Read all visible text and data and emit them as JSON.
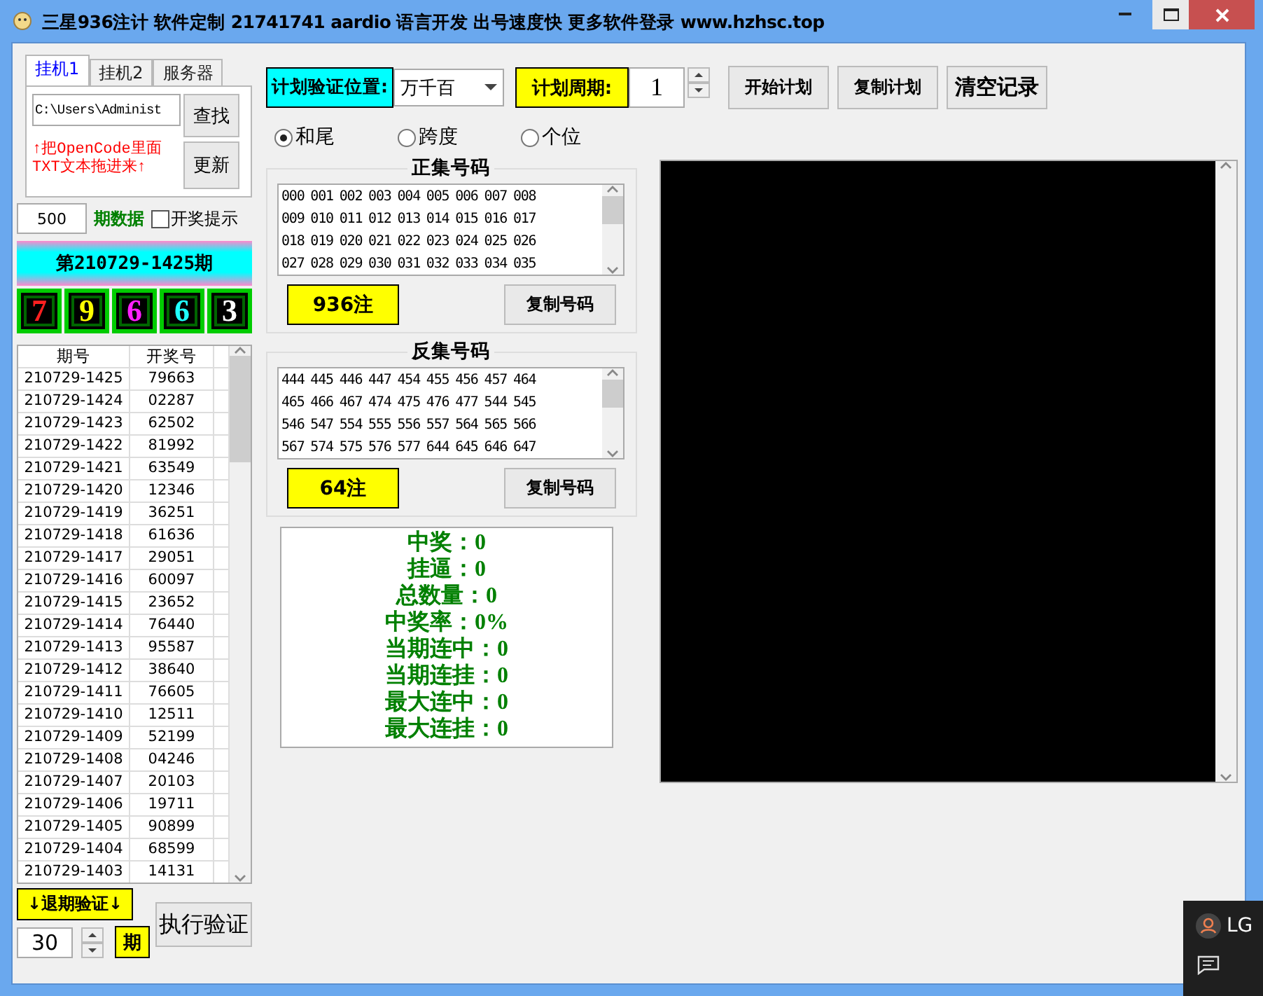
{
  "window": {
    "title": "三星936注计 软件定制 21741741 aardio 语言开发 出号速度快 更多软件登录 www.hzhsc.top"
  },
  "tabs": [
    {
      "label": "挂机1",
      "selected": true
    },
    {
      "label": "挂机2",
      "selected": false
    },
    {
      "label": "服务器",
      "selected": false
    }
  ],
  "path_field": {
    "value": "C:\\Users\\Administ"
  },
  "find_button": "查找",
  "drag_hint": "↑把OpenCode里面TXT文本拖进来↑",
  "update_button": "更新",
  "periods_field": {
    "value": "500"
  },
  "periods_label": "期数据",
  "draw_alert": {
    "label": "开奖提示",
    "checked": false
  },
  "current_period": "第210729-1425期",
  "digits": [
    {
      "value": "7",
      "color": "#ff2020"
    },
    {
      "value": "9",
      "color": "#ffff00"
    },
    {
      "value": "6",
      "color": "#ff20ff"
    },
    {
      "value": "6",
      "color": "#20ffff"
    },
    {
      "value": "3",
      "color": "#ffffff"
    }
  ],
  "table": {
    "columns": [
      "期号",
      "开奖号"
    ],
    "rows": [
      [
        "210729-1425",
        "79663"
      ],
      [
        "210729-1424",
        "02287"
      ],
      [
        "210729-1423",
        "62502"
      ],
      [
        "210729-1422",
        "81992"
      ],
      [
        "210729-1421",
        "63549"
      ],
      [
        "210729-1420",
        "12346"
      ],
      [
        "210729-1419",
        "36251"
      ],
      [
        "210729-1418",
        "61636"
      ],
      [
        "210729-1417",
        "29051"
      ],
      [
        "210729-1416",
        "60097"
      ],
      [
        "210729-1415",
        "23652"
      ],
      [
        "210729-1414",
        "76440"
      ],
      [
        "210729-1413",
        "95587"
      ],
      [
        "210729-1412",
        "38640"
      ],
      [
        "210729-1411",
        "76605"
      ],
      [
        "210729-1410",
        "12511"
      ],
      [
        "210729-1409",
        "52199"
      ],
      [
        "210729-1408",
        "04246"
      ],
      [
        "210729-1407",
        "20103"
      ],
      [
        "210729-1406",
        "19711"
      ],
      [
        "210729-1405",
        "90899"
      ],
      [
        "210729-1404",
        "68599"
      ],
      [
        "210729-1403",
        "14131"
      ]
    ]
  },
  "backtest_label": "↓退期验证↓",
  "backtest_field": {
    "value": "30"
  },
  "backtest_unit": "期",
  "run_button": "执行验证",
  "plan_position": {
    "label": "计划验证位置:",
    "value": "万千百"
  },
  "plan_cycle": {
    "label": "计划周期:",
    "value": "1"
  },
  "toolbar_buttons": [
    "开始计划",
    "复制计划",
    "清空记录"
  ],
  "modes": [
    {
      "label": "和尾",
      "selected": true
    },
    {
      "label": "跨度",
      "selected": false
    },
    {
      "label": "个位",
      "selected": false
    }
  ],
  "groups": [
    {
      "title": "正集号码",
      "lines": [
        "000 001 002 003 004 005 006 007 008",
        "009 010 011 012 013 014 015 016 017",
        "018 019 020 021 022 023 024 025 026",
        "027 028 029 030 031 032 033 034 035"
      ],
      "count": "936注",
      "copy_button": "复制号码"
    },
    {
      "title": "反集号码",
      "lines": [
        "444 445 446 447 454 455 456 457 464",
        "465 466 467 474 475 476 477 544 545",
        "546 547 554 555 556 557 564 565 566",
        "567 574 575 576 577 644 645 646 647"
      ],
      "count": "64注",
      "copy_button": "复制号码"
    }
  ],
  "stats": [
    "中奖：0",
    "挂逼：0",
    "总数量：0",
    "中奖率：0%",
    "当期连中：0",
    "当期连挂：0",
    "最大连中：0",
    "最大连挂：0"
  ],
  "taskbar_popup": {
    "text": "LG"
  }
}
